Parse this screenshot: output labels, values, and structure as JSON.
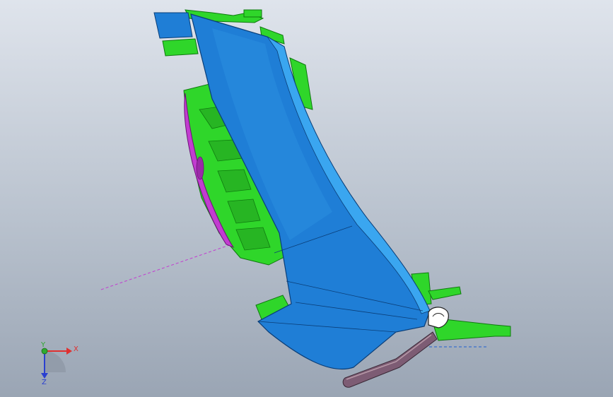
{
  "viewport": {
    "background_top": "#dfe4ec",
    "background_bottom": "#9aa5b4"
  },
  "model": {
    "colors": {
      "body_blue": "#1f7ed6",
      "edge_blue": "#3aa6f0",
      "green": "#2fd62a",
      "magenta": "#c23cd0",
      "gasket": "#7d5c74",
      "gasket_light": "#b89aa8"
    },
    "parts": [
      "blue-panel",
      "green-bracket",
      "magenta-pad",
      "gasket-strip",
      "seal-clip"
    ]
  },
  "triad": {
    "x_label": "X",
    "y_label": "Y",
    "z_label": "Z",
    "x_color": "#e03030",
    "y_color": "#2faa2f",
    "z_color": "#2a3fd0"
  }
}
